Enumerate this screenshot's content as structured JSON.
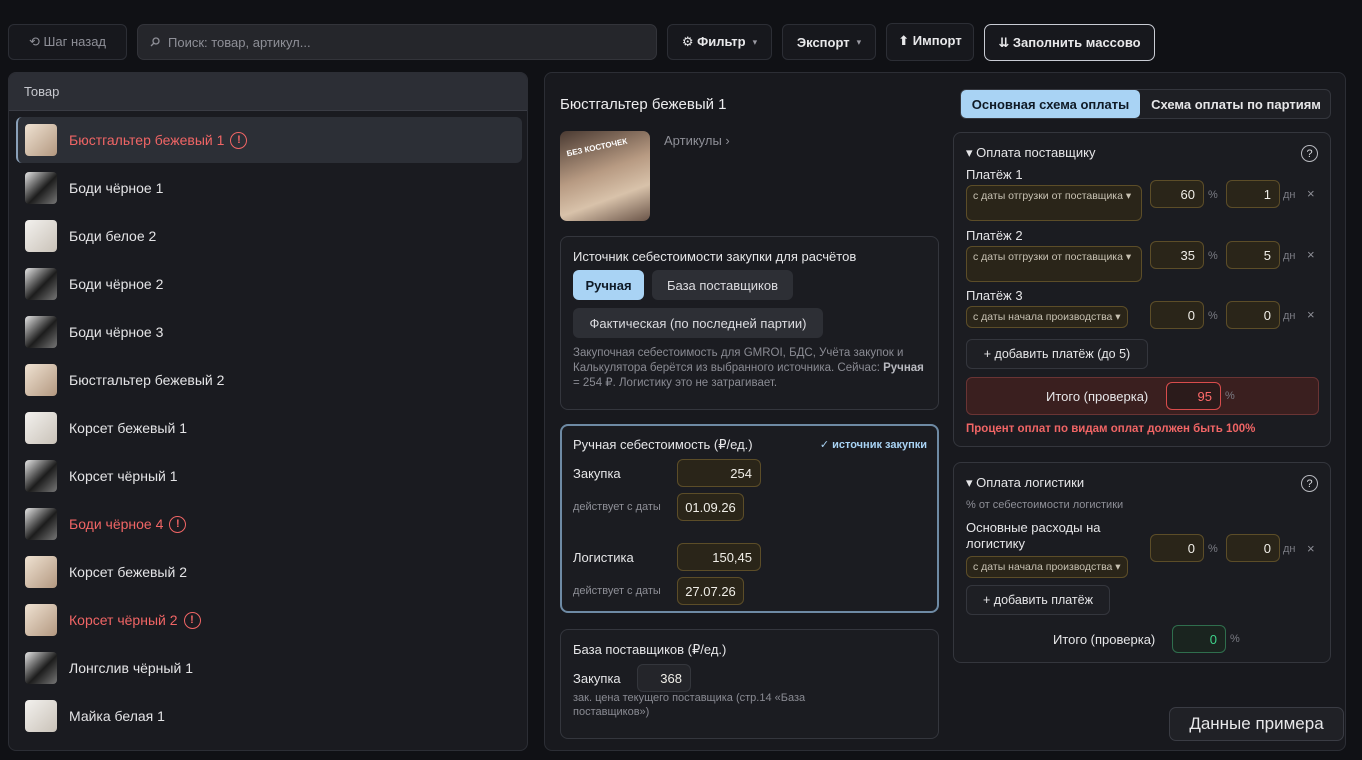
{
  "toolbar": {
    "back_label": "⟲ Шаг назад",
    "search_placeholder": "Поиск: товар, артикул...",
    "filter_label": "⚙ Фильтр",
    "export_label": "Экспорт",
    "import_label": "⬆ Импорт",
    "fill_label": "⇊ Заполнить массово"
  },
  "products": {
    "header": "Товар",
    "items": [
      {
        "name": "Бюстгальтер бежевый 1",
        "error": true,
        "selected": true
      },
      {
        "name": "Боди чёрное 1",
        "error": false
      },
      {
        "name": "Боди белое 2",
        "error": false
      },
      {
        "name": "Боди чёрное 2",
        "error": false
      },
      {
        "name": "Боди чёрное 3",
        "error": false
      },
      {
        "name": "Бюстгальтер бежевый 2",
        "error": false
      },
      {
        "name": "Корсет бежевый 1",
        "error": false
      },
      {
        "name": "Корсет чёрный 1",
        "error": false
      },
      {
        "name": "Боди чёрное 4",
        "error": true
      },
      {
        "name": "Корсет бежевый 2",
        "error": false
      },
      {
        "name": "Корсет чёрный 2",
        "error": true
      },
      {
        "name": "Лонгслив чёрный 1",
        "error": false
      },
      {
        "name": "Майка белая 1",
        "error": false
      }
    ],
    "error_mark": "!"
  },
  "detail": {
    "title": "Бюстгальтер бежевый 1",
    "image_text": "БЕЗ КОСТОЧЕК",
    "articles_label": "Артикулы ›",
    "source_card": {
      "title": "Источник себестоимости закупки для расчётов",
      "manual_btn": "Ручная",
      "suppliers_btn": "База поставщиков",
      "actual_btn": "Фактическая (по последней партии)",
      "note_text": "Закупочная себестоимость для GMROI, БДС, Учёта закупок и Калькулятора берётся из выбранного источника. Сейчас:",
      "note_bold": "Ручная",
      "note_tail": "= 254 ₽. Логистику это не затрагивает."
    },
    "manual_card": {
      "title": "Ручная себестоимость (₽/ед.)",
      "badge": "✓ источник закупки",
      "purchase_label": "Закупка",
      "purchase_value": "254",
      "purchase_date_label": "действует с даты",
      "purchase_date": "01.09.26",
      "logistics_label": "Логистика",
      "logistics_value": "150,45",
      "logistics_date_label": "действует с даты",
      "logistics_date": "27.07.26"
    },
    "suppliers_card": {
      "title": "База поставщиков (₽/ед.)",
      "purchase_label": "Закупка",
      "purchase_value": "368",
      "note": "зак. цена текущего поставщика (стр.14 «База поставщиков»)"
    }
  },
  "payment_tabs": {
    "main": "Основная схема оплаты",
    "batches": "Схема оплаты по партиям"
  },
  "supplier_payment": {
    "title": "▾  Оплата поставщику",
    "help": "?",
    "payments": [
      {
        "label": "Платёж 1",
        "base": "с даты отгрузки от поставщика ▾",
        "percent": "60",
        "days": "1"
      },
      {
        "label": "Платёж 2",
        "base": "с даты отгрузки от поставщика ▾",
        "percent": "35",
        "days": "5"
      },
      {
        "label": "Платёж 3",
        "base": "с даты начала производства ▾",
        "percent": "0",
        "days": "0"
      }
    ],
    "percent_unit": "%",
    "days_unit": "дн",
    "remove": "×",
    "add_label": "+ добавить платёж (до 5)",
    "total_label": "Итого (проверка)",
    "total_value": "95",
    "total_unit": "%",
    "error_text": "Процент оплат по видам оплат должен быть 100%"
  },
  "logistics_payment": {
    "title": "▾  Оплата логистики",
    "help": "?",
    "subtitle": "% от себестоимости логистики",
    "expense_label": "Основные расходы на логистику",
    "base": "с даты начала производства ▾",
    "percent": "0",
    "days": "0",
    "percent_unit": "%",
    "days_unit": "дн",
    "remove": "×",
    "add_label": "+ добавить платёж",
    "total_label": "Итого (проверка)",
    "total_value": "0",
    "total_unit": "%"
  },
  "sample_button": "Данные примера",
  "colors": {
    "accent": "#a9d3f4",
    "error": "#f06565",
    "success": "#3ed38a",
    "field_border": "#5c4d28"
  }
}
